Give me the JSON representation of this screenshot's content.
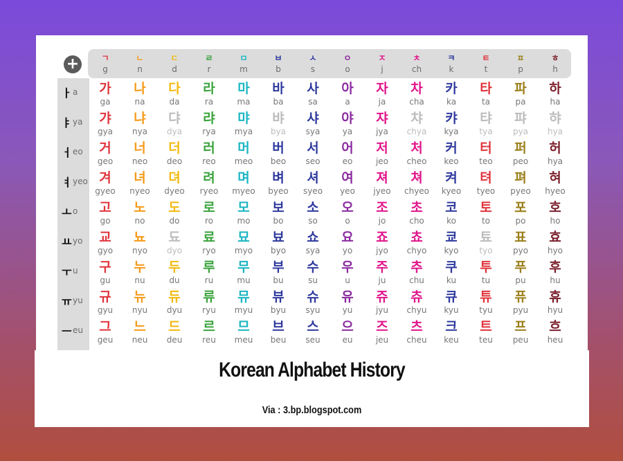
{
  "header": {
    "add_icon": "plus-icon",
    "add_label": "+"
  },
  "colors": [
    "#e0343c",
    "#f59a19",
    "#f2b90e",
    "#3aa33c",
    "#1bb6c3",
    "#2f3a9e",
    "#2f3a9e",
    "#8b2aa0",
    "#e0148a",
    "#e0148a",
    "#2f3a9e",
    "#e0343c",
    "#9b7f1a",
    "#7a1f2b"
  ],
  "consonants": [
    {
      "jamo": "ㄱ",
      "rom": "g"
    },
    {
      "jamo": "ㄴ",
      "rom": "n"
    },
    {
      "jamo": "ㄷ",
      "rom": "d"
    },
    {
      "jamo": "ㄹ",
      "rom": "r"
    },
    {
      "jamo": "ㅁ",
      "rom": "m"
    },
    {
      "jamo": "ㅂ",
      "rom": "b"
    },
    {
      "jamo": "ㅅ",
      "rom": "s"
    },
    {
      "jamo": "ㅇ",
      "rom": "o"
    },
    {
      "jamo": "ㅈ",
      "rom": "j"
    },
    {
      "jamo": "ㅊ",
      "rom": "ch"
    },
    {
      "jamo": "ㅋ",
      "rom": "k"
    },
    {
      "jamo": "ㅌ",
      "rom": "t"
    },
    {
      "jamo": "ㅍ",
      "rom": "p"
    },
    {
      "jamo": "ㅎ",
      "rom": "h"
    }
  ],
  "vowels": [
    {
      "jamo": "ㅏ",
      "rom": "a"
    },
    {
      "jamo": "ㅑ",
      "rom": "ya"
    },
    {
      "jamo": "ㅓ",
      "rom": "eo"
    },
    {
      "jamo": "ㅕ",
      "rom": "yeo"
    },
    {
      "jamo": "ㅗ",
      "rom": "o"
    },
    {
      "jamo": "ㅛ",
      "rom": "yo"
    },
    {
      "jamo": "ㅜ",
      "rom": "u"
    },
    {
      "jamo": "ㅠ",
      "rom": "yu"
    },
    {
      "jamo": "ㅡ",
      "rom": "eu"
    }
  ],
  "rows": [
    {
      "chars": [
        "가",
        "나",
        "다",
        "라",
        "마",
        "바",
        "사",
        "아",
        "자",
        "차",
        "카",
        "타",
        "파",
        "하"
      ],
      "roms": [
        "ga",
        "na",
        "da",
        "ra",
        "ma",
        "ba",
        "sa",
        "a",
        "ja",
        "cha",
        "ka",
        "ta",
        "pa",
        "ha"
      ]
    },
    {
      "chars": [
        "갸",
        "냐",
        "댜",
        "랴",
        "먀",
        "뱌",
        "샤",
        "야",
        "쟈",
        "챠",
        "캬",
        "탸",
        "퍄",
        "햐"
      ],
      "roms": [
        "gya",
        "nya",
        "dya",
        "rya",
        "mya",
        "bya",
        "sya",
        "ya",
        "jya",
        "chya",
        "kya",
        "tya",
        "pya",
        "hya"
      ]
    },
    {
      "chars": [
        "거",
        "너",
        "더",
        "러",
        "머",
        "버",
        "서",
        "어",
        "저",
        "처",
        "커",
        "터",
        "퍼",
        "허"
      ],
      "roms": [
        "geo",
        "neo",
        "deo",
        "reo",
        "meo",
        "beo",
        "seo",
        "eo",
        "jeo",
        "cheo",
        "keo",
        "teo",
        "peo",
        "hya"
      ]
    },
    {
      "chars": [
        "겨",
        "녀",
        "뎌",
        "려",
        "며",
        "벼",
        "셔",
        "여",
        "져",
        "쳐",
        "켜",
        "텨",
        "펴",
        "혀"
      ],
      "roms": [
        "gyeo",
        "nyeo",
        "dyeo",
        "ryeo",
        "myeo",
        "byeo",
        "syeo",
        "yeo",
        "jyeo",
        "chyeo",
        "kyeo",
        "tyeo",
        "pyeo",
        "hyeo"
      ]
    },
    {
      "chars": [
        "고",
        "노",
        "도",
        "로",
        "모",
        "보",
        "소",
        "오",
        "조",
        "초",
        "코",
        "토",
        "포",
        "호"
      ],
      "roms": [
        "go",
        "no",
        "do",
        "ro",
        "mo",
        "bo",
        "so",
        "o",
        "jo",
        "cho",
        "ko",
        "to",
        "po",
        "ho"
      ]
    },
    {
      "chars": [
        "교",
        "뇨",
        "됴",
        "료",
        "묘",
        "뵤",
        "쇼",
        "요",
        "죠",
        "쵸",
        "쿄",
        "툐",
        "표",
        "효"
      ],
      "roms": [
        "gyo",
        "nyo",
        "dyo",
        "ryo",
        "myo",
        "byo",
        "sya",
        "yo",
        "jyo",
        "chyo",
        "kyo",
        "tyo",
        "pyo",
        "hyo"
      ]
    },
    {
      "chars": [
        "구",
        "누",
        "두",
        "루",
        "무",
        "부",
        "수",
        "우",
        "주",
        "추",
        "쿠",
        "투",
        "푸",
        "후"
      ],
      "roms": [
        "gu",
        "nu",
        "du",
        "ru",
        "mu",
        "bu",
        "su",
        "u",
        "ju",
        "chu",
        "ku",
        "tu",
        "pu",
        "hu"
      ]
    },
    {
      "chars": [
        "규",
        "뉴",
        "듀",
        "류",
        "뮤",
        "뷰",
        "슈",
        "유",
        "쥬",
        "츄",
        "큐",
        "튜",
        "퓨",
        "휴"
      ],
      "roms": [
        "gyu",
        "nyu",
        "dyu",
        "ryu",
        "myu",
        "byu",
        "syu",
        "yu",
        "jyu",
        "chyu",
        "kyu",
        "tyu",
        "pyu",
        "hyu"
      ]
    },
    {
      "chars": [
        "그",
        "느",
        "드",
        "르",
        "므",
        "브",
        "스",
        "으",
        "즈",
        "츠",
        "크",
        "트",
        "프",
        "흐"
      ],
      "roms": [
        "geu",
        "neu",
        "deu",
        "reu",
        "meu",
        "beu",
        "seu",
        "eu",
        "jeu",
        "cheu",
        "keu",
        "teu",
        "peu",
        "heu"
      ]
    }
  ],
  "faded": [
    [
      1,
      2
    ],
    [
      1,
      5
    ],
    [
      1,
      9
    ],
    [
      1,
      11
    ],
    [
      1,
      12
    ],
    [
      1,
      13
    ],
    [
      5,
      2
    ],
    [
      5,
      11
    ]
  ],
  "caption": {
    "title": "Korean Alphabet History",
    "source": "Via : 3.bp.blogspot.com"
  }
}
